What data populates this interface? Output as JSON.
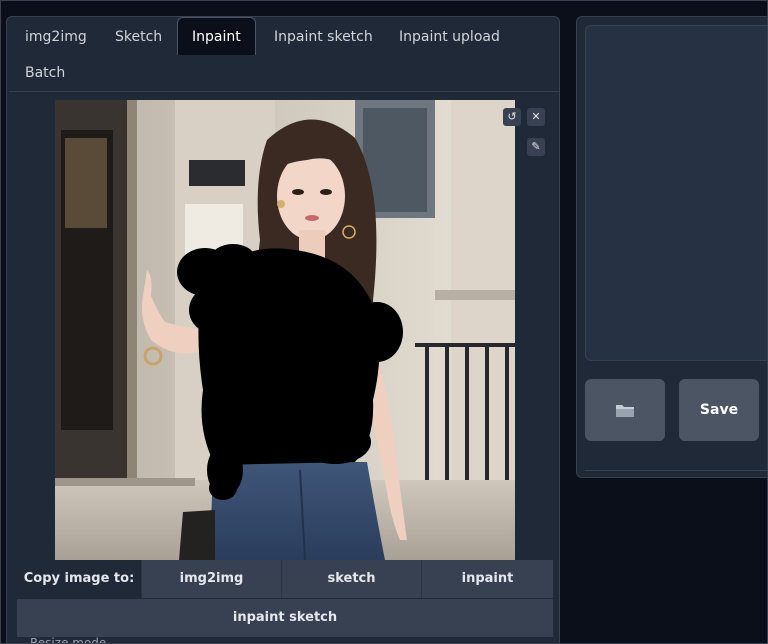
{
  "tabs": [
    {
      "label": "img2img"
    },
    {
      "label": "Sketch"
    },
    {
      "label": "Inpaint"
    },
    {
      "label": "Inpaint sketch"
    },
    {
      "label": "Inpaint upload"
    },
    {
      "label": "Batch"
    }
  ],
  "active_tab": "Inpaint",
  "image_tools": {
    "undo_icon": "undo-icon",
    "close_icon": "close-icon",
    "brush_icon": "brush-icon"
  },
  "copy_to": {
    "label": "Copy image to:",
    "buttons": [
      "img2img",
      "sketch",
      "inpaint"
    ],
    "second_row": "inpaint sketch"
  },
  "cut_text": "Resize mode",
  "right_panel": {
    "folder_icon": "folder-icon",
    "save_label": "Save"
  },
  "colors": {
    "background": "#0b0f19",
    "panel": "#1f2937",
    "button": "#4b5563",
    "mask": "#000000"
  }
}
